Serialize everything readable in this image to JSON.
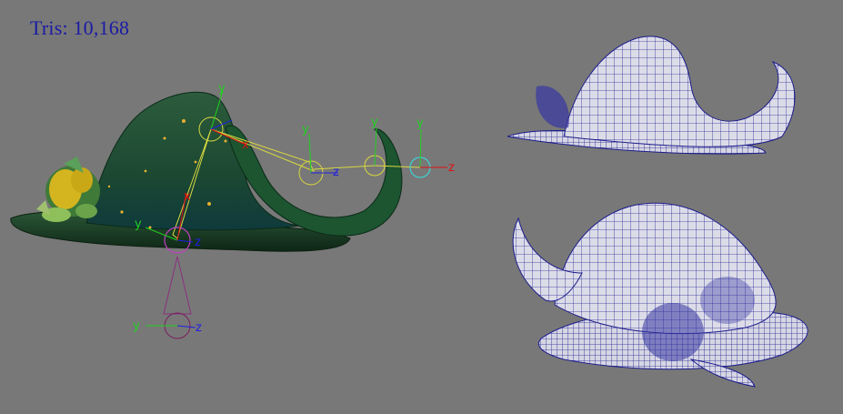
{
  "viewport": {
    "background": "#787878",
    "stats": {
      "label": "Tris: 10,168",
      "color": "#1a1aa6"
    }
  },
  "rig": {
    "axis_labels": {
      "x": "x",
      "y": "y",
      "z": "z"
    },
    "colors": {
      "x_axis": "#e01010",
      "y_axis": "#20d020",
      "z_axis": "#2020e0",
      "joint": "#d8d840",
      "hat_green": "#1f4a2c"
    }
  },
  "wireframes": {
    "color": "#1c1c8c",
    "surface": "#d9d9e6"
  }
}
